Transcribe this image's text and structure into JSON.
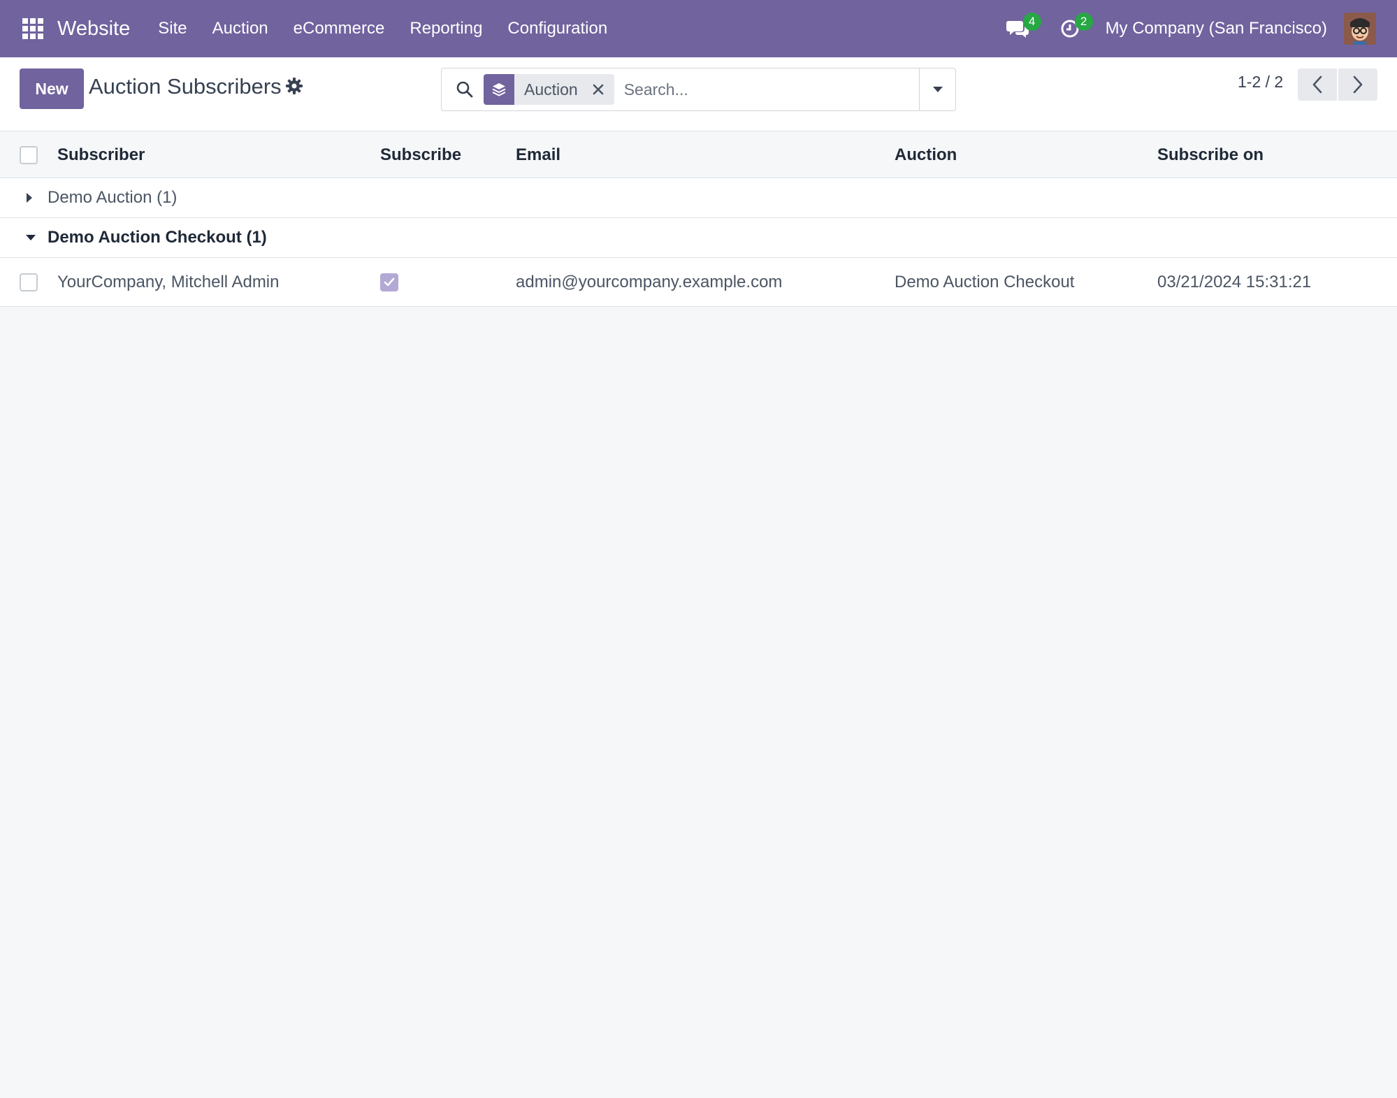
{
  "navbar": {
    "app_name": "Website",
    "menu": [
      "Site",
      "Auction",
      "eCommerce",
      "Reporting",
      "Configuration"
    ],
    "messages_count": "4",
    "activities_count": "2",
    "company": "My Company (San Francisco)",
    "accent_color": "#71639e",
    "badge_color": "#28a745"
  },
  "control_panel": {
    "new_label": "New",
    "title": "Auction Subscribers",
    "search": {
      "facet_label": "Auction",
      "placeholder": "Search..."
    },
    "pager": "1-2 / 2"
  },
  "table": {
    "columns": [
      "Subscriber",
      "Subscribe",
      "Email",
      "Auction",
      "Subscribe on"
    ],
    "groups": [
      {
        "label": "Demo Auction (1)",
        "expanded": false
      },
      {
        "label": "Demo Auction Checkout (1)",
        "expanded": true
      }
    ],
    "rows": [
      {
        "subscriber": "YourCompany, Mitchell Admin",
        "subscribe": true,
        "email": "admin@yourcompany.example.com",
        "auction": "Demo Auction Checkout",
        "subscribe_on": "03/21/2024 15:31:21"
      }
    ]
  }
}
